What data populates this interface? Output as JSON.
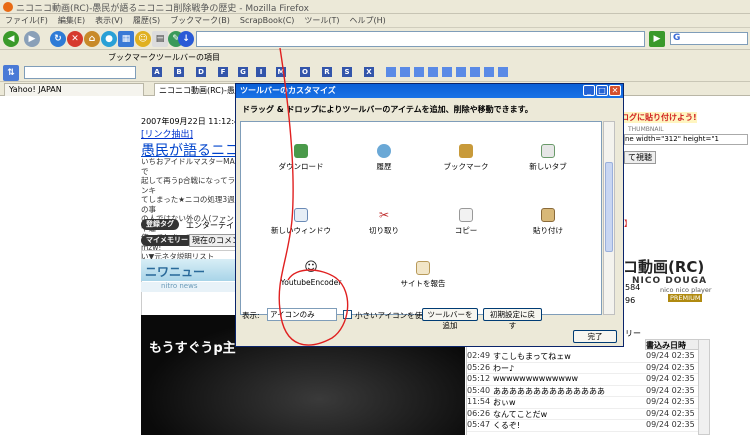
{
  "window": {
    "title": "ニコニコ動画(RC)-愚民が語るニコニコ削除戦争の歴史 - Mozilla Firefox"
  },
  "menu": [
    "ファイル(F)",
    "編集(E)",
    "表示(V)",
    "履歴(S)",
    "ブックマーク(B)",
    "ScrapBook(C)",
    "ツール(T)",
    "ヘルプ(H)"
  ],
  "bookmark_toolbar_label": "ブックマークツールバーの項目",
  "search_toolbar_buttons": [
    "A",
    "B",
    "D",
    "F",
    "G",
    "I",
    "M",
    "O",
    "R",
    "S",
    "X"
  ],
  "tabs": [
    {
      "label": "Yahoo! JAPAN"
    },
    {
      "label": "ニコニコ動画(RC)-愚民が語る..."
    }
  ],
  "page": {
    "date": "2007年09月22日 11:12:49 投稿",
    "link_extract": "[リンク抽出]",
    "title": "愚民が語るニコニコ",
    "desc": [
      "いちおアイドルマスターMADで",
      "起して再うp合戦になってランキ",
      "てしまった★ニコの処理3週の事",
      "の人ではない外の人(ファンや運",
      "使ってしまっていませんのmzw!",
      "い▼元ネタ説明リストhttp://www"
    ],
    "tag_pill": "登録タグ",
    "tag_text": "エンターテイメ",
    "mymemory_pill": "マイメモリー",
    "current_comment": "現在のコメント",
    "banner_text": "ニワニュー",
    "banner_sub": "nitro news",
    "video_caption": "もうすぐうp主",
    "right_banner": "ログに貼り付けよう!",
    "thumb_label": "THUMBNAIL",
    "embed_code": "ne width=\"312\" height=\"1",
    "view_button": "て視聴",
    "nico_logo": "コ動画(RC)",
    "nico_logo_en": "NICO DOUGA",
    "nico_player": "nico nico player",
    "premium": "PREMIUM",
    "counter1": "584",
    "counter2": "96",
    "counter_label": "リー",
    "comment_header_date": "書込み日時",
    "comments": [
      {
        "time": "02:49",
        "text": "すこしもまってねェw",
        "date": "09/24 02:35"
      },
      {
        "time": "05:26",
        "text": "わー♪",
        "date": "09/24 02:35"
      },
      {
        "time": "05:12",
        "text": "wwwwwwwwwwwww",
        "date": "09/24 02:35"
      },
      {
        "time": "05:40",
        "text": "ああああああああああああああ",
        "date": "09/24 02:35"
      },
      {
        "time": "11:54",
        "text": "おぃw",
        "date": "09/24 02:35"
      },
      {
        "time": "06:26",
        "text": "なんてことだw",
        "date": "09/24 02:35"
      },
      {
        "time": "05:47",
        "text": "くるぞ!",
        "date": "09/24 02:35"
      }
    ]
  },
  "dialog": {
    "title": "ツールバーのカスタマイズ",
    "instruction": "ドラッグ & ドロップによりツールバーのアイテムを追加、削除や移動できます。",
    "items": [
      {
        "label": "ダウンロード",
        "icon": "download-icon"
      },
      {
        "label": "履歴",
        "icon": "history-icon"
      },
      {
        "label": "ブックマーク",
        "icon": "bookmark-icon"
      },
      {
        "label": "新しいタブ",
        "icon": "new-tab-icon"
      },
      {
        "label": "新しいウィンドウ",
        "icon": "new-window-icon"
      },
      {
        "label": "切り取り",
        "icon": "scissors-icon"
      },
      {
        "label": "コピー",
        "icon": "copy-icon"
      },
      {
        "label": "貼り付け",
        "icon": "paste-icon"
      },
      {
        "label": "YoutubeEncoder",
        "icon": "smiley-icon"
      },
      {
        "label": "サイトを報告",
        "icon": "report-site-icon"
      }
    ],
    "show_label": "表示:",
    "show_value": "アイコンのみ",
    "small_icons_label": "小さいアイコンを使用",
    "add_toolbar_btn": "ツールバーを追加",
    "restore_btn": "初期設定に戻す",
    "done_btn": "完了"
  },
  "colors": {
    "highlight_circle": "#e02020",
    "dialog_title": "#0a5fd6",
    "link": "#0033cc"
  }
}
